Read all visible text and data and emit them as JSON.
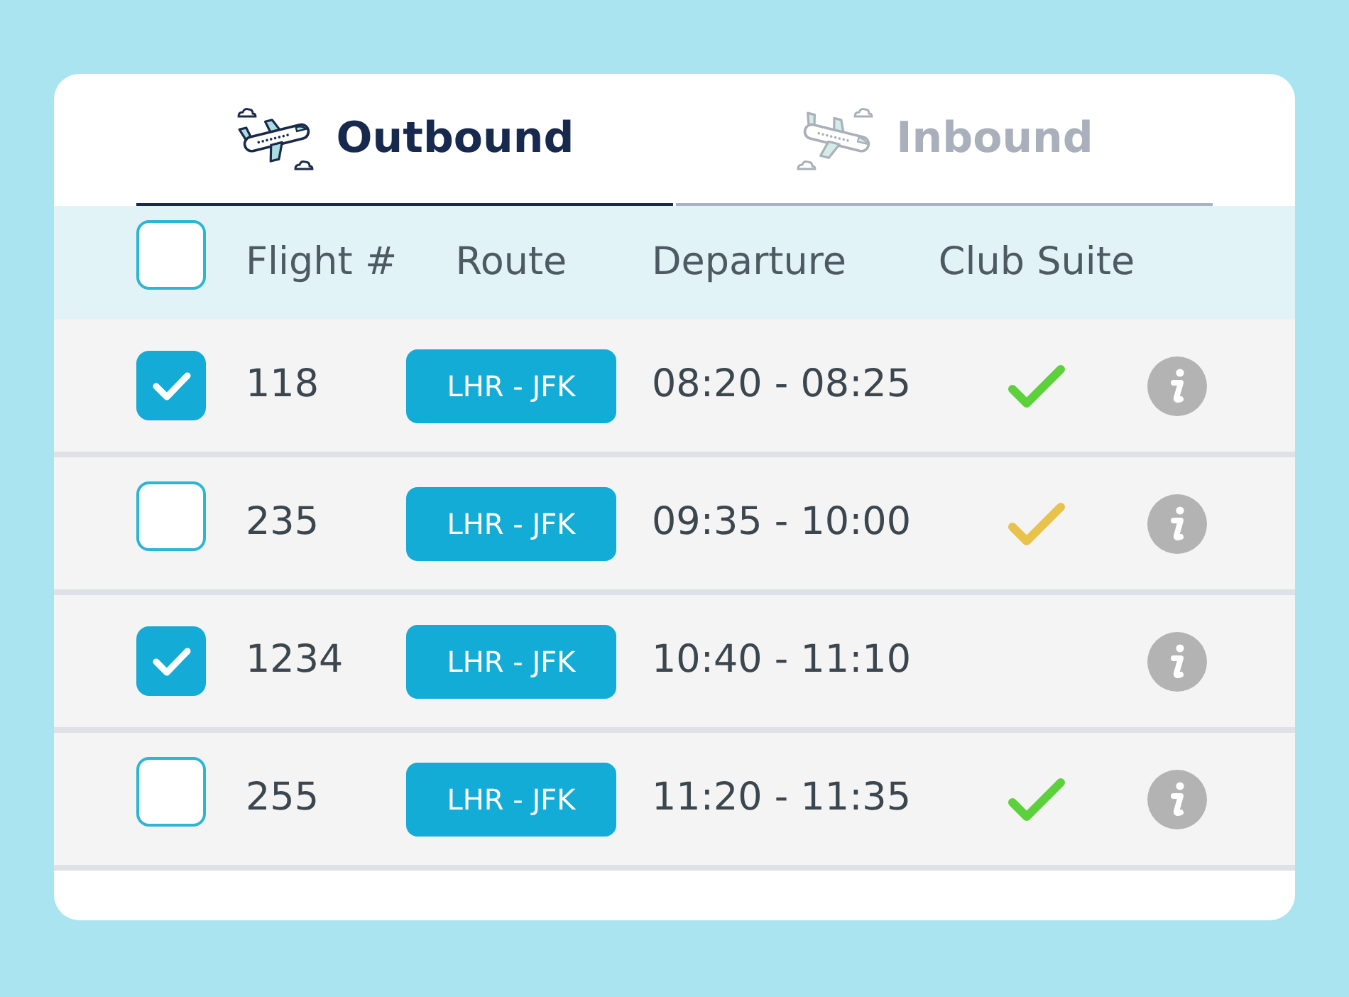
{
  "tabs": [
    {
      "label": "Outbound",
      "selected": true
    },
    {
      "label": "Inbound",
      "selected": false
    }
  ],
  "table": {
    "select_all": {
      "checked": false
    },
    "columns": [
      "Flight #",
      "Route",
      "Departure",
      "Club Suite"
    ],
    "rows": [
      {
        "checked": true,
        "flight": "118",
        "route": "LHR - JFK",
        "departure": "08:20 - 08:25",
        "club_suite": {
          "color": "#5dd13c"
        }
      },
      {
        "checked": false,
        "flight": "235",
        "route": "LHR - JFK",
        "departure": "09:35 - 10:00",
        "club_suite": {
          "color": "#e8c24a"
        }
      },
      {
        "checked": true,
        "flight": "1234",
        "route": "LHR - JFK",
        "departure": "10:40 - 11:10"
      },
      {
        "checked": false,
        "flight": "255",
        "route": "LHR - JFK",
        "departure": "11:20 - 11:35",
        "club_suite": {
          "color": "#5dd13c"
        }
      }
    ]
  }
}
